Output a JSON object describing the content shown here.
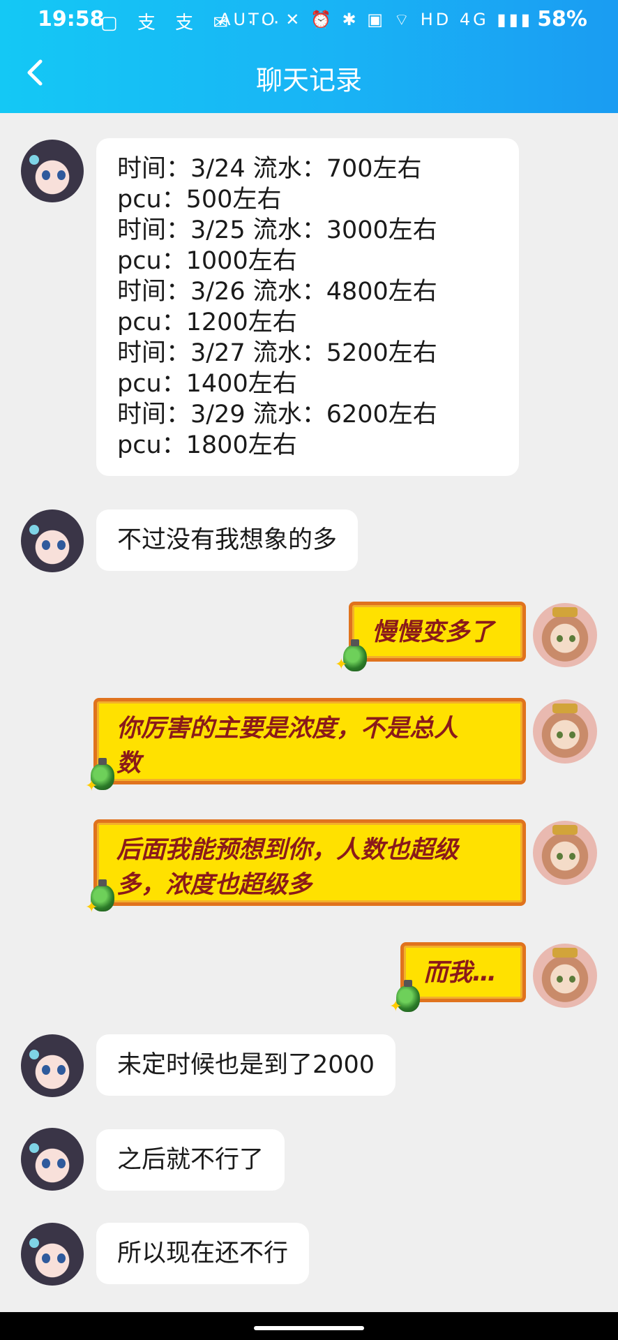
{
  "status_bar": {
    "time": "19:58",
    "left_icons": "▢ 支 支 ✉ ···",
    "right_icons": "AUTO ✕ ⏰ ✱ ▣ ⌔ HD 4G ▮▮▮",
    "battery": "58%"
  },
  "nav": {
    "title": "聊天记录",
    "back_icon": "chevron-left-icon"
  },
  "messages": [
    {
      "side": "left",
      "lines": [
        "时间：3/24   流水：700左右",
        "pcu：500左右",
        "时间：3/25   流水：3000左右",
        "pcu：1000左右",
        "时间：3/26   流水：4800左右",
        "pcu：1200左右",
        "时间：3/27   流水：5200左右",
        "pcu：1400左右",
        "时间：3/29   流水：6200左右",
        "pcu：1800左右"
      ]
    },
    {
      "side": "left",
      "text": "不过没有我想象的多"
    },
    {
      "side": "right",
      "lines": [
        "慢慢变多了"
      ]
    },
    {
      "side": "right",
      "lines": [
        "你厉害的主要是浓度，不是总人",
        "数"
      ]
    },
    {
      "side": "right",
      "lines": [
        "后面我能预想到你，人数也超级",
        "多，浓度也超级多"
      ]
    },
    {
      "side": "right",
      "lines": [
        "而我…"
      ]
    },
    {
      "side": "left",
      "text": "未定时候也是到了2000"
    },
    {
      "side": "left",
      "text": "之后就不行了"
    },
    {
      "side": "left",
      "text": "所以现在还不行"
    }
  ],
  "colors": {
    "header_start": "#14c8f5",
    "header_end": "#1a9cf2",
    "chat_bg": "#efefef",
    "yellow_bubble": "#ffe100",
    "yellow_bubble_border": "#e0731e",
    "yellow_text": "#8a1a1a"
  }
}
